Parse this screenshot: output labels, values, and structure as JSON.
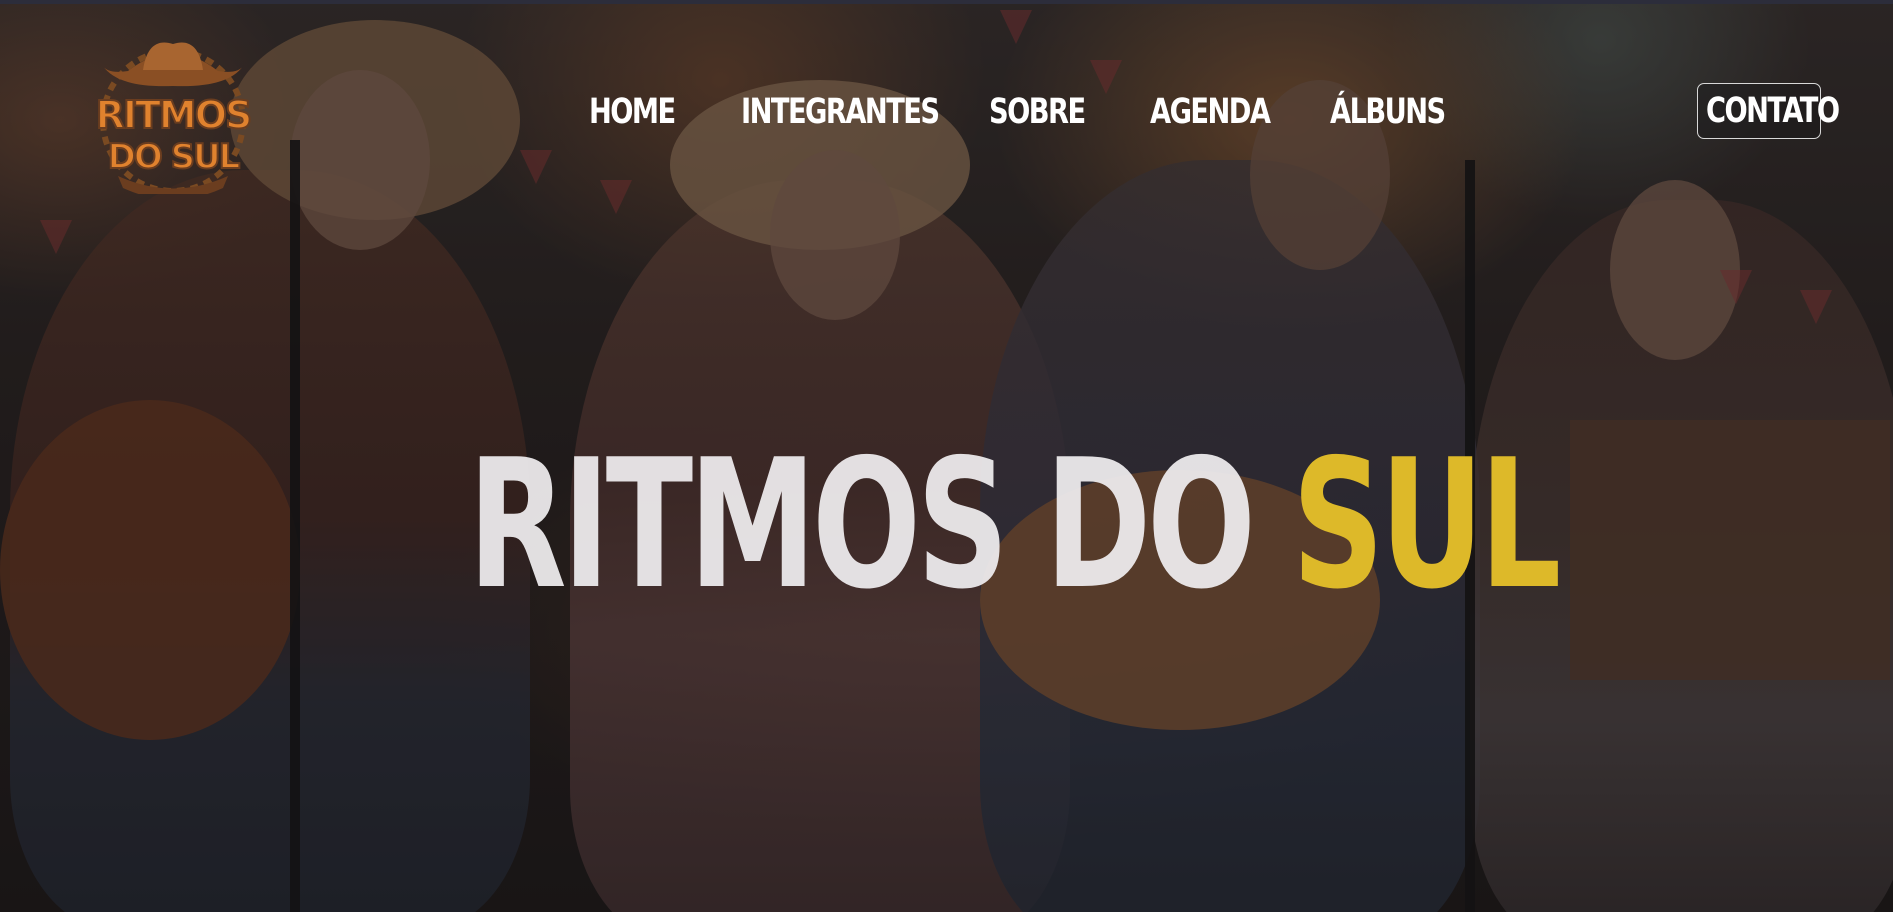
{
  "brand": {
    "logo_alt": "Ritmos do Sul logo",
    "logo_line1": "RITMOS",
    "logo_line2": "DO SUL"
  },
  "nav": {
    "items": [
      {
        "label": "HOME"
      },
      {
        "label": "INTEGRANTES"
      },
      {
        "label": "SOBRE"
      },
      {
        "label": "AGENDA"
      },
      {
        "label": "ÁLBUNS"
      }
    ],
    "cta_label": "CONTATO"
  },
  "hero": {
    "title_main": "RITMOS DO ",
    "title_accent": "SUL"
  },
  "colors": {
    "accent": "#ddb929",
    "text": "#ffffff",
    "logo_orange": "#e0822e",
    "logo_brown": "#6b3d1f"
  },
  "icons": {
    "logo": "cowboy-hat-logo-icon"
  }
}
